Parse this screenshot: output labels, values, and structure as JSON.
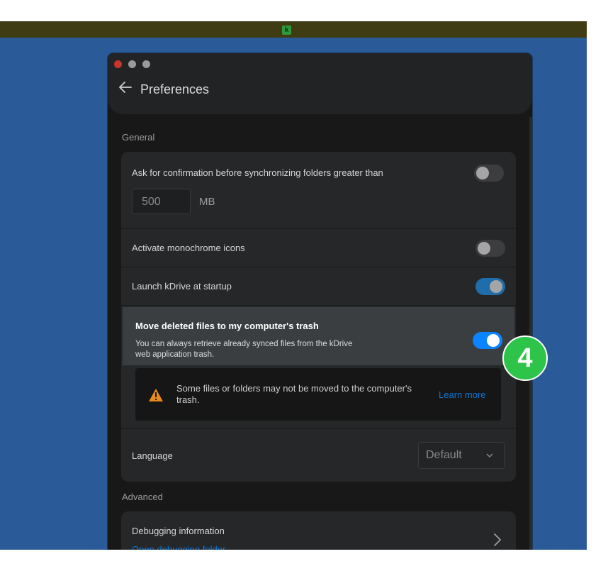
{
  "topbar": {
    "app_icon_letter": "k"
  },
  "window": {
    "title": "Preferences",
    "back_icon": "arrow-left-icon"
  },
  "general": {
    "section_label": "General",
    "confirm_label": "Ask for confirmation before synchronizing folders greater than",
    "confirm_enabled": false,
    "size_value": "500",
    "size_unit": "MB",
    "monochrome_label": "Activate monochrome icons",
    "monochrome_enabled": false,
    "startup_label": "Launch kDrive at startup",
    "startup_enabled": true,
    "trash_title": "Move deleted files to my computer's trash",
    "trash_description": "You can always retrieve already synced files from the kDrive web application trash.",
    "trash_enabled": true,
    "warning_text": "Some files or folders may not be moved to the computer's trash.",
    "learn_more": "Learn more",
    "language_label": "Language",
    "language_value": "Default"
  },
  "advanced": {
    "section_label": "Advanced",
    "debug_title": "Debugging information",
    "debug_link": "Open debugging folder"
  },
  "callout": {
    "number": "4"
  },
  "colors": {
    "desktop": "#2a5a97",
    "accent_blue": "#0b84ff",
    "callout_green": "#2ec44a",
    "warning": "#e8891c"
  }
}
